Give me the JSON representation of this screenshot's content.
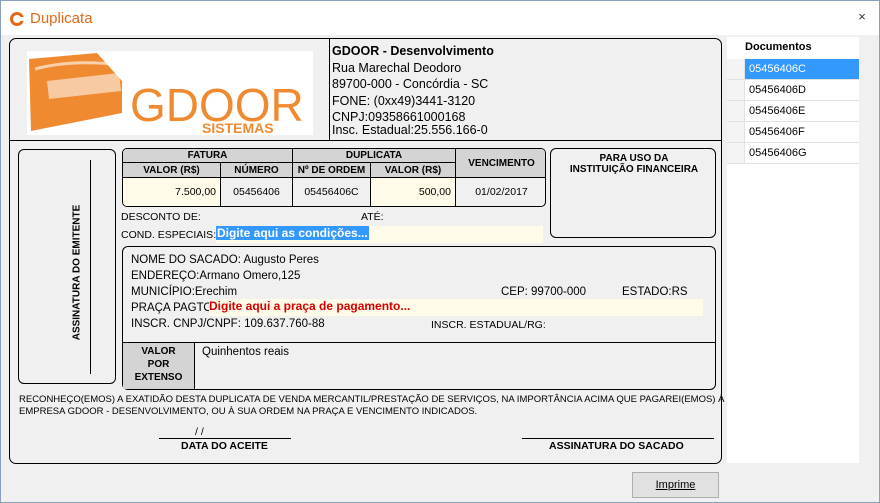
{
  "window": {
    "title": "Duplicata",
    "close_glyph": "×",
    "accent": "#e06a18"
  },
  "logo": {
    "text": "GDOOR",
    "subtext": "SISTEMAS",
    "color": "#f08a30"
  },
  "company": {
    "name": "GDOOR - Desenvolvimento",
    "street": "Rua Marechal Deodoro",
    "city": "89700-000 - Concórdia - SC",
    "phone": "FONE: (0xx49)3441-3120",
    "cnpj": "CNPJ:09358661000168",
    "ie": "Insc. Estadual:25.556.166-0"
  },
  "emitente_label": "ASSINATURA DO EMITENTE",
  "fatura": {
    "group_fatura": "FATURA",
    "group_duplicata": "DUPLICATA",
    "col_valor": "VALOR (R$)",
    "col_numero": "NÚMERO",
    "col_ordem": "Nº DE ORDEM",
    "col_valor_dup": "VALOR (R$)",
    "col_vencimento": "VENCIMENTO",
    "valor": "7.500,00",
    "numero": "05456406",
    "ordem": "05456406C",
    "valor_dup": "500,00",
    "vencimento": "01/02/2017"
  },
  "inst_label_1": "PARA USO DA",
  "inst_label_2": "INSTITUIÇÃO FINANCEIRA",
  "desconto_label": "DESCONTO DE:",
  "ate_label": "ATÉ:",
  "cond_label": "COND. ESPECIAIS:",
  "cond_value": "Digite aqui as condições...",
  "sacado": {
    "nome": "NOME DO SACADO: Augusto Peres",
    "endereco": "ENDEREÇO:Armano Omero,125",
    "municipio": "MUNICÍPIO:Erechim",
    "cep": "CEP: 99700-000",
    "estado": "ESTADO:RS",
    "praca_label": "PRAÇA PAGTO:",
    "praca_value": "Digite aqui a praça de pagamento...",
    "cnpj": "INSCR. CNPJ/CNPF: 109.637.760-88",
    "ie": "INSCR. ESTADUAL/RG:",
    "valor_extenso_label_1": "VALOR",
    "valor_extenso_label_2": "POR",
    "valor_extenso_label_3": "EXTENSO",
    "valor_extenso": "Quinhentos reais"
  },
  "declaracao_1": "RECONHEÇO(EMOS) A EXATIDÃO DESTA DUPLICATA DE VENDA MERCANTIL/PRESTAÇÃO DE SERVIÇOS, NA IMPORTÂNCIA ACIMA QUE PAGAREI(EMOS) À",
  "declaracao_2": "EMPRESA GDOOR - DESENVOLVIMENTO, OU À SUA ORDEM NA PRAÇA E VENCIMENTO INDICADOS.",
  "data_slashes": "/          /",
  "data_aceite": "DATA DO ACEITE",
  "assinatura_sacado": "ASSINATURA DO SACADO",
  "documentos": {
    "header": "Documentos",
    "items": [
      "05456406C",
      "05456406D",
      "05456406E",
      "05456406F",
      "05456406G"
    ],
    "selected_index": 0
  },
  "print_button": {
    "label": "Imprime"
  }
}
